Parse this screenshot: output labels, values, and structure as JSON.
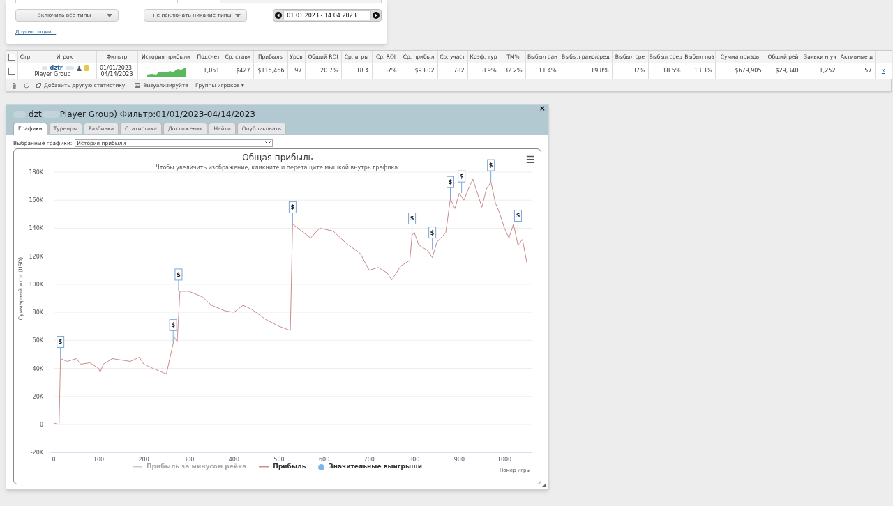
{
  "filters": {
    "include_types": "Включить все типы",
    "exclude_types": "не исключать никакие типы",
    "date_range": "01.01.2023 - 14.04.2023",
    "more_options": "Другие опции..."
  },
  "table": {
    "columns": [
      "Стр",
      "Игрок",
      "Фильтр",
      "История прибыли",
      "Подсчет",
      "Ср. ставк",
      "Прибыль",
      "Уров",
      "Общий ROI",
      "Ср. игры",
      "Ср. ROI",
      "Ср. прибыл",
      "Ср. участ",
      "Коэф. тур",
      "ITM%",
      "Выбыл ран",
      "Выбыл рано/сред",
      "Выбыл сре",
      "Выбыл сред",
      "Выбыл поз",
      "Сумма призов",
      "Общий рей",
      "Заявки н уч",
      "Активные д"
    ],
    "all_selected": false,
    "rows": [
      {
        "selected": false,
        "cells": [
          "",
          {
            "player": "dztr",
            "group": "Player Group"
          },
          "01/01/2023-04/14/2023",
          "",
          "1,051",
          "$427",
          "$116,466",
          "97",
          "20.7%",
          "18.4",
          "37%",
          "$93.02",
          "782",
          "8.9%",
          "32.2%",
          "11.4%",
          "19.8%",
          "37%",
          "18.5%",
          "13.3%",
          "$679,905",
          "$29,340",
          "1,252",
          "57"
        ],
        "remove": "x"
      }
    ],
    "toolbar": {
      "add_stat": "Добавить другую статистику",
      "visualize": "Визуализируйте",
      "groups": "Группы игроков ▾"
    }
  },
  "window": {
    "title_start": "dzt",
    "title_end": "Player Group) Фильтр:01/01/2023-04/14/2023",
    "close": "×",
    "tabs": [
      {
        "label": "Графики",
        "selected": true
      },
      {
        "label": "Турниры",
        "selected": false
      },
      {
        "label": "Разбивка",
        "selected": false
      },
      {
        "label": "Статистика",
        "selected": false
      },
      {
        "label": "Достижения",
        "selected": false
      },
      {
        "label": "Найти",
        "selected": false
      },
      {
        "label": "Опубликовать",
        "selected": false
      }
    ],
    "selector_label": "Выбранные графики:",
    "selector_value": "История прибыли",
    "chart": {
      "hint": "Чтобы увеличить изображение, кликните и перетащите мышкой внутрь графика.",
      "menu": "☰",
      "legend": [
        {
          "label": "Прибыль за минусом рейка",
          "kind": "line",
          "enabled": false
        },
        {
          "kind": "series",
          "enabled": true
        },
        {
          "label": "Значительные выигрыши",
          "kind": "dot",
          "enabled": true
        }
      ],
      "chart_data": {
        "type": "line",
        "grid": true,
        "title": "Общая прибыль",
        "xlabel": "Номер игры",
        "ylabel": "Суммарный итог (USD)",
        "x": [
          0,
          12,
          15,
          30,
          50,
          60,
          80,
          100,
          103,
          110,
          130,
          150,
          170,
          190,
          200,
          220,
          250,
          268,
          274,
          280,
          300,
          330,
          350,
          380,
          400,
          420,
          440,
          470,
          500,
          525,
          530,
          550,
          570,
          590,
          620,
          650,
          680,
          700,
          720,
          740,
          750,
          770,
          790,
          795,
          800,
          810,
          830,
          840,
          850,
          870,
          880,
          890,
          900,
          910,
          920,
          930,
          950,
          960,
          970,
          980,
          990,
          1000,
          1010,
          1020,
          1030,
          1040,
          1050
        ],
        "series": [
          {
            "name": "Прибыль",
            "color": "#c98b8b",
            "values": [
              1000,
              0,
              47000,
              45000,
              47000,
              43000,
              44000,
              40000,
              37000,
              43000,
              47000,
              46000,
              45000,
              48000,
              43000,
              40000,
              36000,
              62000,
              59000,
              95000,
              95000,
              91000,
              85000,
              81000,
              80000,
              85000,
              82000,
              75000,
              70000,
              67000,
              143000,
              138000,
              133000,
              140000,
              138000,
              129000,
              122000,
              110000,
              112000,
              108000,
              103000,
              113000,
              117000,
              135000,
              137000,
              128000,
              124000,
              119000,
              130000,
              137000,
              161000,
              154000,
              165000,
              160000,
              168000,
              175000,
              155000,
              168000,
              173000,
              158000,
              150000,
              140000,
              133000,
              143000,
              128000,
              132000,
              115000
            ]
          }
        ],
        "xlim": [
          -10,
          1060
        ],
        "ylim": [
          -20000,
          180000
        ],
        "xticks": [
          0,
          100,
          200,
          300,
          400,
          500,
          600,
          700,
          800,
          900,
          1000
        ],
        "yticks": [
          {
            "value": -20000,
            "label": "-20K"
          },
          {
            "value": 0,
            "label": "0"
          },
          {
            "value": 20000,
            "label": "20K"
          },
          {
            "value": 40000,
            "label": "40K"
          },
          {
            "value": 60000,
            "label": "60K"
          },
          {
            "value": 80000,
            "label": "80K"
          },
          {
            "value": 100000,
            "label": "100K"
          },
          {
            "value": 120000,
            "label": "120K"
          },
          {
            "value": 140000,
            "label": "140K"
          },
          {
            "value": 160000,
            "label": "160K"
          },
          {
            "value": 180000,
            "label": "180K"
          }
        ],
        "annotations": [
          {
            "x": 15,
            "y": 47000,
            "text": "$"
          },
          {
            "x": 265,
            "y": 59000,
            "text": "$"
          },
          {
            "x": 277,
            "y": 95000,
            "text": "$"
          },
          {
            "x": 530,
            "y": 143000,
            "text": "$"
          },
          {
            "x": 795,
            "y": 135000,
            "text": "$"
          },
          {
            "x": 840,
            "y": 125000,
            "text": "$"
          },
          {
            "x": 880,
            "y": 161000,
            "text": "$"
          },
          {
            "x": 905,
            "y": 165000,
            "text": "$"
          },
          {
            "x": 970,
            "y": 173000,
            "text": "$"
          },
          {
            "x": 1030,
            "y": 137000,
            "text": "$"
          }
        ]
      }
    }
  }
}
